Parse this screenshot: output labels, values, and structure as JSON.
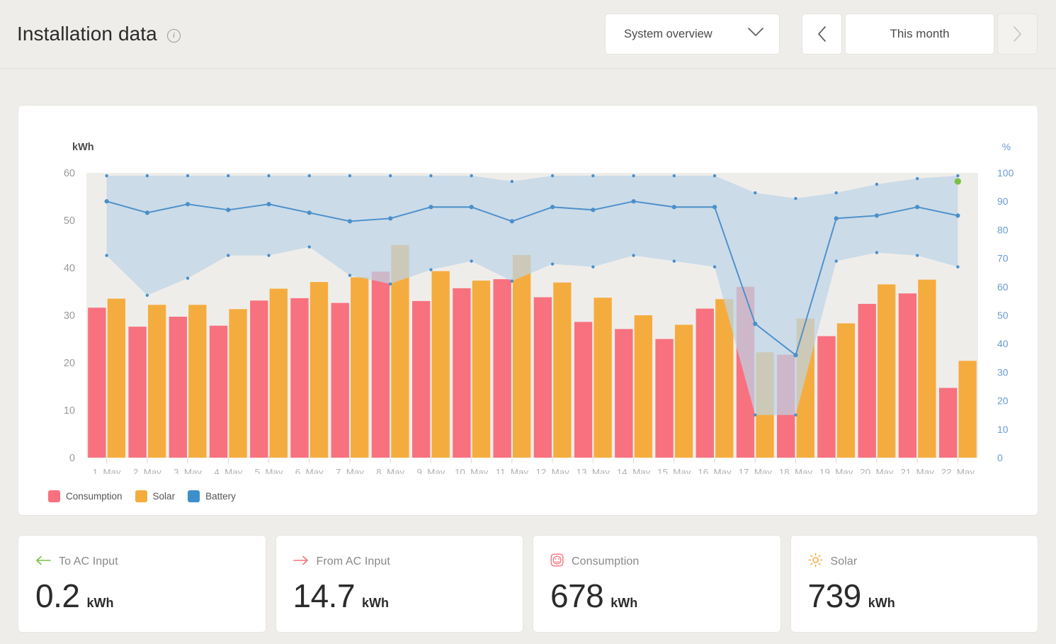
{
  "header": {
    "title": "Installation data",
    "info_icon": "info-icon",
    "system_select": {
      "value": "System overview",
      "chevron": "chevron-down-icon"
    },
    "prev_label": "chevron-left-icon",
    "next_label": "chevron-right-icon",
    "period_label": "This month",
    "next_disabled": true
  },
  "chart_data": {
    "type": "bar",
    "title": "",
    "xlabel": "",
    "ylabel": "kWh",
    "y2label": "%",
    "ylim": [
      0,
      60
    ],
    "y2lim": [
      0,
      100
    ],
    "yticks": [
      0,
      10,
      20,
      30,
      40,
      50,
      60
    ],
    "y2ticks": [
      0,
      10,
      20,
      30,
      40,
      50,
      60,
      70,
      80,
      90,
      100
    ],
    "grid": false,
    "legend_position": "bottom-left",
    "categories": [
      "1. May",
      "2. May",
      "3. May",
      "4. May",
      "5. May",
      "6. May",
      "7. May",
      "8. May",
      "9. May",
      "10. May",
      "11. May",
      "12. May",
      "13. May",
      "14. May",
      "15. May",
      "16. May",
      "17. May",
      "18. May",
      "19. May",
      "20. May",
      "21. May",
      "22. May"
    ],
    "series": [
      {
        "name": "Consumption",
        "unit": "kWh",
        "axis": "left",
        "type": "bar",
        "color": "#f8717f",
        "values": [
          31.6,
          27.6,
          29.7,
          27.8,
          33.1,
          33.6,
          32.6,
          39.2,
          33.0,
          35.7,
          37.6,
          33.8,
          28.6,
          27.1,
          25.0,
          31.4,
          36.0,
          21.7,
          25.6,
          32.4,
          34.6,
          14.7
        ]
      },
      {
        "name": "Solar",
        "unit": "kWh",
        "axis": "left",
        "type": "bar",
        "color": "#f5ac3e",
        "values": [
          33.5,
          32.2,
          32.2,
          31.3,
          35.6,
          37.0,
          38.0,
          44.8,
          39.3,
          37.3,
          42.7,
          36.9,
          33.7,
          30.0,
          28.0,
          33.4,
          22.2,
          29.3,
          28.3,
          36.5,
          37.5,
          20.4
        ]
      },
      {
        "name": "Battery",
        "unit": "%",
        "axis": "right",
        "type": "line",
        "color": "#4a8fca",
        "values": [
          90,
          86,
          89,
          87,
          89,
          86,
          83,
          84,
          88,
          88,
          83,
          88,
          87,
          90,
          88,
          88,
          47,
          36,
          84,
          85,
          88,
          85
        ]
      },
      {
        "name": "Battery max",
        "unit": "%",
        "axis": "right",
        "type": "area-upper",
        "color": "#bdd4e7",
        "values": [
          99,
          99,
          99,
          99,
          99,
          99,
          99,
          99,
          99,
          99,
          97,
          99,
          99,
          99,
          99,
          99,
          93,
          91,
          93,
          96,
          98,
          99
        ]
      },
      {
        "name": "Battery min",
        "unit": "%",
        "axis": "right",
        "type": "area-lower",
        "color": "#bdd4e7",
        "values": [
          71,
          57,
          63,
          71,
          71,
          74,
          64,
          61,
          66,
          69,
          62,
          68,
          67,
          71,
          69,
          67,
          15,
          15,
          69,
          72,
          71,
          67
        ]
      }
    ],
    "current_marker": {
      "name": "current-battery-level",
      "value": 97,
      "color": "#7ac143"
    }
  },
  "legend": [
    {
      "label": "Consumption",
      "color": "#f8717f"
    },
    {
      "label": "Solar",
      "color": "#f5ac3e"
    },
    {
      "label": "Battery",
      "color": "#3d8fcc"
    }
  ],
  "stats": [
    {
      "icon": "arrow-left-icon",
      "icon_color": "#7ac143",
      "label": "To AC Input",
      "value": "0.2",
      "unit": "kWh"
    },
    {
      "icon": "arrow-right-icon",
      "icon_color": "#f8717f",
      "label": "From AC Input",
      "value": "14.7",
      "unit": "kWh"
    },
    {
      "icon": "socket-icon",
      "icon_color": "#f8717f",
      "label": "Consumption",
      "value": "678",
      "unit": "kWh"
    },
    {
      "icon": "sun-icon",
      "icon_color": "#f5ac3e",
      "label": "Solar",
      "value": "739",
      "unit": "kWh"
    }
  ]
}
